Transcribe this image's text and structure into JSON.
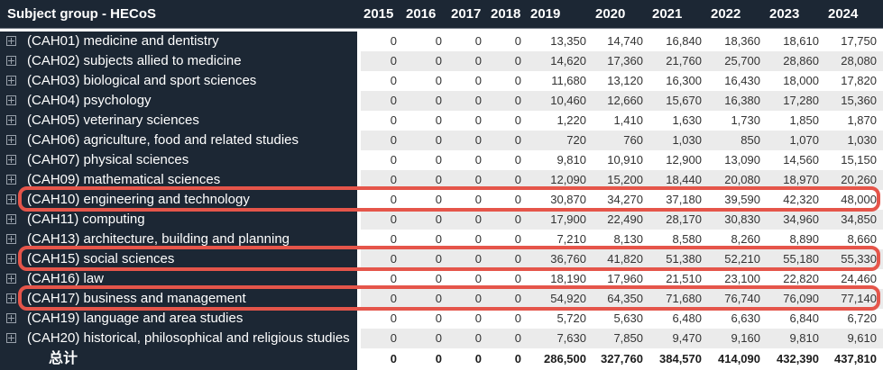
{
  "table": {
    "corner_label": "Subject group - HECoS",
    "years": [
      "2015",
      "2016",
      "2017",
      "2018",
      "2019",
      "2020",
      "2021",
      "2022",
      "2023",
      "2024"
    ],
    "rows": [
      {
        "label": "(CAH01) medicine and dentistry",
        "expandable": true,
        "highlighted": false,
        "total": false,
        "values": [
          "0",
          "0",
          "0",
          "0",
          "13,350",
          "14,740",
          "16,840",
          "18,360",
          "18,610",
          "17,750"
        ]
      },
      {
        "label": "(CAH02) subjects allied to medicine",
        "expandable": true,
        "highlighted": false,
        "total": false,
        "values": [
          "0",
          "0",
          "0",
          "0",
          "14,620",
          "17,360",
          "21,760",
          "25,700",
          "28,860",
          "28,080"
        ]
      },
      {
        "label": "(CAH03) biological and sport sciences",
        "expandable": true,
        "highlighted": false,
        "total": false,
        "values": [
          "0",
          "0",
          "0",
          "0",
          "11,680",
          "13,120",
          "16,300",
          "16,430",
          "18,000",
          "17,820"
        ]
      },
      {
        "label": "(CAH04) psychology",
        "expandable": true,
        "highlighted": false,
        "total": false,
        "values": [
          "0",
          "0",
          "0",
          "0",
          "10,460",
          "12,660",
          "15,670",
          "16,380",
          "17,280",
          "15,360"
        ]
      },
      {
        "label": "(CAH05) veterinary sciences",
        "expandable": true,
        "highlighted": false,
        "total": false,
        "values": [
          "0",
          "0",
          "0",
          "0",
          "1,220",
          "1,410",
          "1,630",
          "1,730",
          "1,850",
          "1,870"
        ]
      },
      {
        "label": "(CAH06) agriculture, food and related studies",
        "expandable": true,
        "highlighted": false,
        "total": false,
        "values": [
          "0",
          "0",
          "0",
          "0",
          "720",
          "760",
          "1,030",
          "850",
          "1,070",
          "1,030"
        ]
      },
      {
        "label": "(CAH07) physical sciences",
        "expandable": true,
        "highlighted": false,
        "total": false,
        "values": [
          "0",
          "0",
          "0",
          "0",
          "9,810",
          "10,910",
          "12,900",
          "13,090",
          "14,560",
          "15,150"
        ]
      },
      {
        "label": "(CAH09) mathematical sciences",
        "expandable": true,
        "highlighted": false,
        "total": false,
        "values": [
          "0",
          "0",
          "0",
          "0",
          "12,090",
          "15,200",
          "18,440",
          "20,080",
          "18,970",
          "20,260"
        ]
      },
      {
        "label": "(CAH10) engineering and technology",
        "expandable": true,
        "highlighted": true,
        "total": false,
        "values": [
          "0",
          "0",
          "0",
          "0",
          "30,870",
          "34,270",
          "37,180",
          "39,590",
          "42,320",
          "48,000"
        ]
      },
      {
        "label": "(CAH11) computing",
        "expandable": true,
        "highlighted": false,
        "total": false,
        "values": [
          "0",
          "0",
          "0",
          "0",
          "17,900",
          "22,490",
          "28,170",
          "30,830",
          "34,960",
          "34,850"
        ]
      },
      {
        "label": "(CAH13) architecture, building and planning",
        "expandable": true,
        "highlighted": false,
        "total": false,
        "values": [
          "0",
          "0",
          "0",
          "0",
          "7,210",
          "8,130",
          "8,580",
          "8,260",
          "8,890",
          "8,660"
        ]
      },
      {
        "label": "(CAH15) social sciences",
        "expandable": true,
        "highlighted": true,
        "total": false,
        "values": [
          "0",
          "0",
          "0",
          "0",
          "36,760",
          "41,820",
          "51,380",
          "52,210",
          "55,180",
          "55,330"
        ]
      },
      {
        "label": "(CAH16) law",
        "expandable": true,
        "highlighted": false,
        "total": false,
        "values": [
          "0",
          "0",
          "0",
          "0",
          "18,190",
          "17,960",
          "21,510",
          "23,100",
          "22,820",
          "24,460"
        ]
      },
      {
        "label": "(CAH17) business and management",
        "expandable": true,
        "highlighted": true,
        "total": false,
        "values": [
          "0",
          "0",
          "0",
          "0",
          "54,920",
          "64,350",
          "71,680",
          "76,740",
          "76,090",
          "77,140"
        ]
      },
      {
        "label": "(CAH19) language and area studies",
        "expandable": true,
        "highlighted": false,
        "total": false,
        "values": [
          "0",
          "0",
          "0",
          "0",
          "5,720",
          "5,630",
          "6,480",
          "6,630",
          "6,840",
          "6,720"
        ]
      },
      {
        "label": "(CAH20) historical, philosophical and religious studies",
        "expandable": true,
        "highlighted": false,
        "total": false,
        "values": [
          "0",
          "0",
          "0",
          "0",
          "7,630",
          "7,850",
          "9,470",
          "9,160",
          "9,810",
          "9,610"
        ]
      },
      {
        "label": "总计",
        "expandable": false,
        "highlighted": false,
        "total": true,
        "values": [
          "0",
          "0",
          "0",
          "0",
          "286,500",
          "327,760",
          "384,570",
          "414,090",
          "432,390",
          "437,810"
        ]
      }
    ]
  },
  "icons": {
    "expand": "plus-in-box-icon"
  },
  "colors": {
    "header_bg": "#1c2734",
    "band_bg": "#ebebeb",
    "highlight_border": "#e5554a",
    "header_text": "#ffffff",
    "number_text": "#333333",
    "icon_gray": "#99a1ab"
  }
}
